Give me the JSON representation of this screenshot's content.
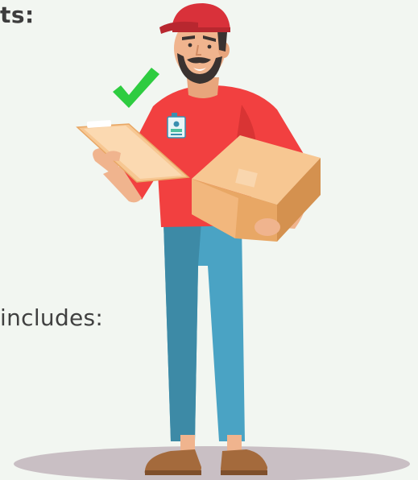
{
  "heading_fragment": "ts:",
  "body_fragment": "includes:",
  "illustration": {
    "subject": "delivery-worker",
    "icons": [
      "check-mark-icon",
      "id-badge-icon",
      "clipboard-icon",
      "cardboard-box-icon",
      "cap-icon"
    ]
  },
  "colors": {
    "background": "#f2f6f1",
    "text": "#3d3d3d",
    "shirt": "#f24040",
    "cap": "#d9313a",
    "pants": "#4aa3c4",
    "box": "#f2b77d",
    "check": "#2ecc40",
    "shadow": "#c9bfc4"
  }
}
